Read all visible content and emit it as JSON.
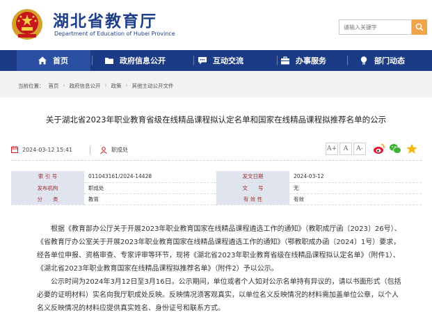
{
  "header": {
    "site_title": "湖北省教育厅",
    "site_subtitle": "Department of Education of Hubei Province",
    "search_placeholder": "请输入关键字"
  },
  "nav": {
    "items": [
      {
        "label": "首页",
        "icon": "home-icon"
      },
      {
        "label": "政府信息公开",
        "icon": "folder-icon"
      },
      {
        "label": "互动交流",
        "icon": "chat-icon"
      },
      {
        "label": "办事服务",
        "icon": "briefcase-icon"
      },
      {
        "label": "部门动态",
        "icon": "bulb-icon"
      }
    ]
  },
  "breadcrumb": {
    "prefix": "当前位置：",
    "items": [
      "首页",
      "政府信息公开",
      "政策",
      "其他主动公开文件"
    ]
  },
  "article": {
    "title": "关于湖北省2023年职业教育省级在线精品课程拟认定名单和国家在线精品课程拟推荐名单的公示",
    "date": "2024-03-12 15:41",
    "source": "职成处",
    "font_buttons": [
      "A+",
      "A",
      "A-"
    ]
  },
  "info_table": [
    [
      "索 引 号",
      "011043161/2024-14428",
      "发文日期",
      "2024-03-12"
    ],
    [
      "发布机构",
      "职成处",
      "文　　号",
      "无"
    ],
    [
      "分　　类",
      "教育",
      "有 效 性",
      "有效"
    ]
  ],
  "content": {
    "paragraphs": [
      "根据《教育部办公厅关于开展2023年职业教育国家在线精品课程遴选工作的通知》（教职成厅函〔2023〕26号）、《省教育厅办公室关于开展2023年职业教育国家在线精品课程遴选工作的通知》（鄂教职成办函〔2024〕1号）要求，经各单位申报、资格审查、专家评审等环节，现将《湖北省2023年职业教育省级在线精品课程拟认定名单》（附件1）、《湖北省2023年职业教育国家在线精品课程拟推荐名单》（附件2）予以公示。",
      "公示时间为2024年3月12日至3月16日。公示期间，单位或者个人如对公示名单持有异议的，请以书面形式（包括必要的证明材料）实名向我厅职成处反映。反映情况须客观真实，以单位名义反映情况的材料需加盖单位公章，以个人名义反映情况的材料应提供真实姓名、身份证号和联系方式。"
    ]
  },
  "colors": {
    "brand_blue": "#1c3b86",
    "nav_active": "#2a4fa3",
    "search_button": "#f0a44a",
    "table_label_bg": "#dfe4ef",
    "table_label_text": "#a33131"
  }
}
